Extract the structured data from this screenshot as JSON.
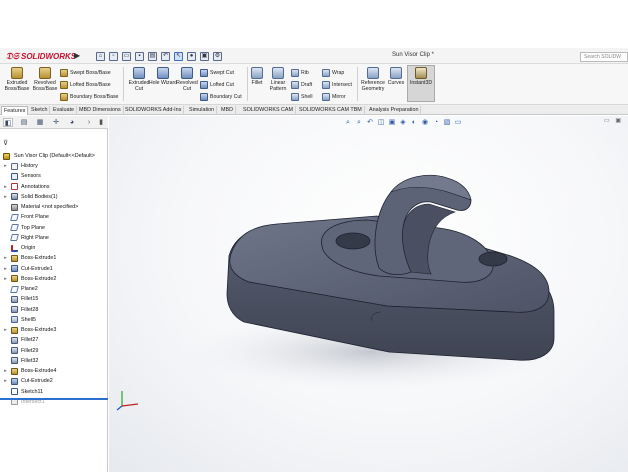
{
  "app": {
    "logo_text": "SOLIDWORKS",
    "document_title": "Sun Visor Clip *",
    "search_placeholder": "Search SOLIDW"
  },
  "quick_access": [
    "home-icon",
    "new-doc-icon",
    "open-icon",
    "save-icon",
    "print-icon",
    "undo-icon",
    "select-arrow-icon",
    "traffic-light-icon",
    "record-icon",
    "options-gear-icon"
  ],
  "command_manager": {
    "extruded_boss": "Extruded Boss/Base",
    "revolved_boss": "Revolved Boss/Base",
    "swept_boss": "Swept Boss/Base",
    "lofted_boss": "Lofted Boss/Base",
    "boundary_boss": "Boundary Boss/Base",
    "extruded_cut": "Extruded Cut",
    "hole_wizard": "Hole Wizard",
    "revolved_cut": "Revolved Cut",
    "swept_cut": "Swept Cut",
    "lofted_cut": "Lofted Cut",
    "boundary_cut": "Boundary Cut",
    "fillet": "Fillet",
    "linear_pattern": "Linear Pattern",
    "rib": "Rib",
    "draft": "Draft",
    "shell": "Shell",
    "wrap": "Wrap",
    "intersect": "Intersect",
    "mirror": "Mirror",
    "reference_geometry": "Reference Geometry",
    "curves": "Curves",
    "instant3d": "Instant3D"
  },
  "tabs": [
    "Features",
    "Sketch",
    "Evaluate",
    "MBD Dimensions",
    "SOLIDWORKS Add-Ins",
    "Simulation",
    "MBD",
    "SOLIDWORKS CAM",
    "SOLIDWORKS CAM TBM",
    "Analysis Preparation"
  ],
  "active_tab": "Features",
  "tree": {
    "root": "Sun Visor Clip  (Default<<Default>",
    "items": [
      {
        "label": "History",
        "icon": "history-icon",
        "caret": "▸"
      },
      {
        "label": "Sensors",
        "icon": "sensors-icon",
        "caret": ""
      },
      {
        "label": "Annotations",
        "icon": "annotations-icon",
        "caret": "▸"
      },
      {
        "label": "Solid Bodies(1)",
        "icon": "solid-bodies-icon",
        "caret": "▸"
      },
      {
        "label": "Material <not specified>",
        "icon": "material-icon",
        "caret": ""
      },
      {
        "label": "Front Plane",
        "icon": "plane-icon",
        "caret": ""
      },
      {
        "label": "Top Plane",
        "icon": "plane-icon",
        "caret": ""
      },
      {
        "label": "Right Plane",
        "icon": "plane-icon",
        "caret": ""
      },
      {
        "label": "Origin",
        "icon": "origin-icon",
        "caret": ""
      },
      {
        "label": "Boss-Extrude1",
        "icon": "boss-extrude-icon",
        "caret": "▸"
      },
      {
        "label": "Cut-Extrude1",
        "icon": "cut-extrude-icon",
        "caret": "▸"
      },
      {
        "label": "Boss-Extrude2",
        "icon": "boss-extrude-icon",
        "caret": "▸"
      },
      {
        "label": "Plane2",
        "icon": "plane-icon",
        "caret": ""
      },
      {
        "label": "Fillet15",
        "icon": "fillet-icon",
        "caret": ""
      },
      {
        "label": "Fillet28",
        "icon": "fillet-icon",
        "caret": ""
      },
      {
        "label": "Shell5",
        "icon": "shell-icon",
        "caret": ""
      },
      {
        "label": "Boss-Extrude3",
        "icon": "boss-extrude-icon",
        "caret": "▸"
      },
      {
        "label": "Fillet27",
        "icon": "fillet-icon",
        "caret": ""
      },
      {
        "label": "Fillet29",
        "icon": "fillet-icon",
        "caret": ""
      },
      {
        "label": "Fillet32",
        "icon": "fillet-icon",
        "caret": ""
      },
      {
        "label": "Boss-Extrude4",
        "icon": "boss-extrude-icon",
        "caret": "▸"
      },
      {
        "label": "Cut-Extrude2",
        "icon": "cut-extrude-icon",
        "caret": "▸"
      },
      {
        "label": "Sketch11",
        "icon": "sketch-icon",
        "caret": ""
      },
      {
        "label": "Intersect1",
        "icon": "intersect-icon",
        "caret": "",
        "greyed": true
      }
    ]
  },
  "colors": {
    "brand_red": "#c8102e",
    "model_fill": "#5d6478",
    "rollback_bar": "#2b6fd1",
    "accent_blue": "#2d5aa8"
  }
}
